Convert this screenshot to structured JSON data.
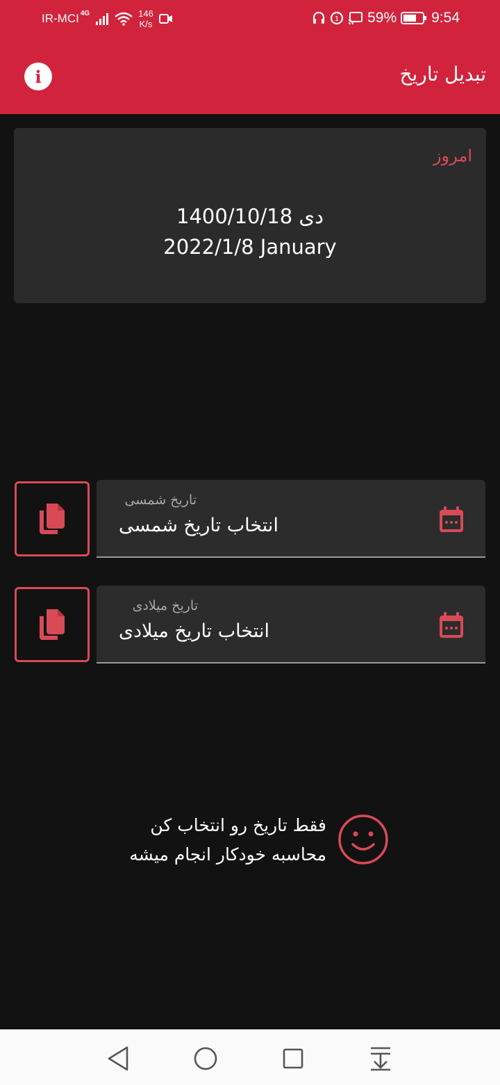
{
  "status_bar": {
    "carrier": "IR-MCI",
    "network": "4G",
    "speed_value": "146",
    "speed_unit": "K/s",
    "battery": "59%",
    "time": "9:54"
  },
  "app_bar": {
    "title": "تبدیل تاریخ",
    "info_icon": "info-icon"
  },
  "today": {
    "label": "امروز",
    "shamsi": "دی 1400/10/18",
    "gregorian": "2022/1/8 January"
  },
  "fields": [
    {
      "label": "تاریخ شمسی",
      "value": "انتخاب تاریخ شمسی",
      "icon": "calendar-icon",
      "copy_icon": "copy-icon"
    },
    {
      "label": "تاریخ میلادی",
      "value": "انتخاب تاریخ میلادی",
      "icon": "calendar-icon",
      "copy_icon": "copy-icon"
    }
  ],
  "hint": {
    "line1": "فقط تاریخ رو انتخاب کن",
    "line2": "محاسبه خودکار انجام میشه",
    "icon": "smiley-icon"
  },
  "colors": {
    "accent": "#d2233c",
    "accent_light": "#d94a57",
    "background": "#121212",
    "card": "#2b2b2b"
  }
}
